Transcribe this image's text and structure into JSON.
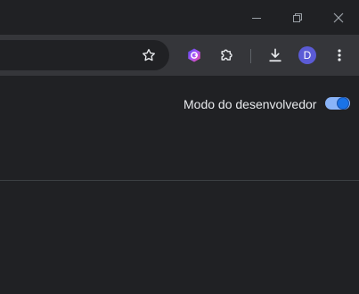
{
  "window": {
    "minimize_icon": "minimize-icon",
    "restore_icon": "restore-icon",
    "close_icon": "close-icon"
  },
  "toolbar": {
    "bookmark_icon": "star-icon",
    "extension_icons": [
      "colorful-extension-icon",
      "puzzle-icon"
    ],
    "download_icon": "download-icon",
    "profile_initial": "D",
    "menu_icon": "kebab-menu-icon"
  },
  "devmode": {
    "label": "Modo do desenvolvedor",
    "enabled": true
  },
  "colors": {
    "background": "#202124",
    "toolbar": "#35363a",
    "accent": "#8ab4f8",
    "toggle_thumb": "#1a73e8",
    "avatar": "#5b5bd6"
  }
}
